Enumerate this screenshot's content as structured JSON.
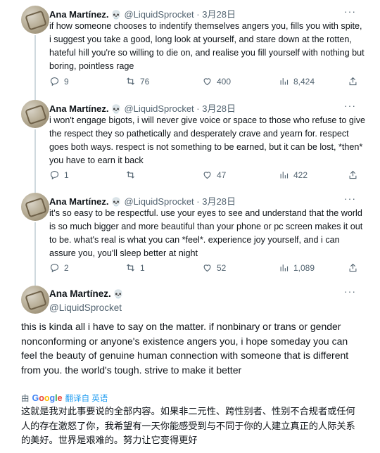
{
  "tweets": [
    {
      "name": "Ana Martínez.",
      "handle": "@LiquidSprocket",
      "dot": "·",
      "date": "3月28日",
      "more": "···",
      "text": "if how someone chooses to indentify themselves angers you, fills you with spite, i suggest you take a good, long look at yourself, and stare down at the rotten, hateful hill you're so willing to die on, and realise you fill yourself with nothing but boring, pointless rage",
      "replies": "9",
      "retweets": "76",
      "likes": "400",
      "views": "8,424"
    },
    {
      "name": "Ana Martínez.",
      "handle": "@LiquidSprocket",
      "dot": "·",
      "date": "3月28日",
      "more": "···",
      "text": "i won't engage bigots, i will never give voice or space to those who refuse to give the respect they so pathetically and desperately crave and yearn for. respect goes both ways. respect is not something to be earned, but it can be lost, *then* you have to earn it back",
      "replies": "1",
      "retweets": "",
      "likes": "47",
      "views": "422"
    },
    {
      "name": "Ana Martínez.",
      "handle": "@LiquidSprocket",
      "dot": "·",
      "date": "3月28日",
      "more": "···",
      "text": "it's so easy to be respectful. use your eyes to see and understand that the world is so much bigger and more beautiful than your phone or pc screen makes it out to be. what's real is what you can *feel*. experience joy yourself, and i can assure you, you'll sleep better at night",
      "replies": "2",
      "retweets": "1",
      "likes": "52",
      "views": "1,089"
    }
  ],
  "main": {
    "name": "Ana Martínez.",
    "handle": "@LiquidSprocket",
    "more": "···",
    "text": "this is kinda all i have to say on the matter. if nonbinary or trans or gender nonconforming or anyone's existence angers you, i hope someday you can feel the beauty of genuine human connection with someone that is different from you. the world's tough. strive to make it better",
    "translate_prefix": "由",
    "translate_brand": "Google",
    "translate_link": "翻译自 英语",
    "translation": "这就是我对此事要说的全部内容。如果非二元性、跨性别者、性别不合规者或任何人的存在激怒了你，我希望有一天你能感受到与不同于你的人建立真正的人际关系的美好。世界是艰难的。努力让它变得更好"
  },
  "icons": [
    "reply-icon",
    "retweet-icon",
    "like-icon",
    "views-icon",
    "share-icon",
    "skull-emoji-icon",
    "more-icon"
  ],
  "colors": {
    "text": "#0f1419",
    "secondary": "#536471",
    "link": "#1d9bf0",
    "divider": "#eff3f4",
    "thread_line": "#cfd9de"
  }
}
